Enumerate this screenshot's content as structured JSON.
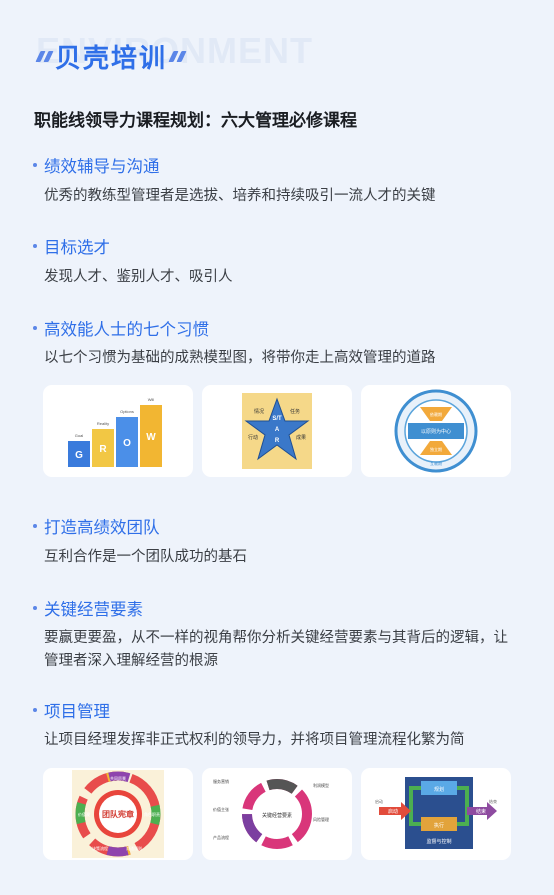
{
  "header": {
    "watermark": "ENVIRONMENT",
    "brand": "贝壳培训"
  },
  "page_title": "职能线领导力课程规划：六大管理必修课程",
  "sections": [
    {
      "title": "绩效辅导与沟通",
      "desc": "优秀的教练型管理者是选拔、培养和持续吸引一流人才的关键"
    },
    {
      "title": "目标选才",
      "desc": "发现人才、鉴别人才、吸引人"
    },
    {
      "title": "高效能人士的七个习惯",
      "desc": "以七个习惯为基础的成熟模型图，将带你走上高效管理的道路"
    },
    {
      "title": "打造高绩效团队",
      "desc": "互利合作是一个团队成功的基石"
    },
    {
      "title": "关键经营要素",
      "desc": "要赢更要盈，从不一样的视角帮你分析关键经营要素与其背后的逻辑，让管理者深入理解经营的根源"
    },
    {
      "title": "项目管理",
      "desc": "让项目经理发挥非正式权利的领导力，并将项目管理流程化繁为简"
    }
  ],
  "gallery1": {
    "grow": {
      "letters": [
        "G",
        "R",
        "O",
        "W"
      ],
      "step_labels": [
        "Goal",
        "Reality",
        "Options",
        "Will"
      ]
    },
    "star": {
      "letters": [
        "S/T",
        "A",
        "R"
      ],
      "labels": [
        "情况",
        "任务",
        "行动",
        "成果"
      ]
    },
    "circle": {
      "labels": [
        "以原则为中心",
        "依赖期",
        "独立期",
        "互赖期"
      ]
    }
  },
  "gallery2": {
    "team": {
      "center": "团队宪章",
      "ring_labels": [
        "共同愿景",
        "角色职责",
        "沟通规则",
        "决策流程",
        "价值观"
      ]
    },
    "wheel": {
      "center": "关键经营要素",
      "labels": [
        "服务营销",
        "价值主张",
        "产品流程",
        "利润模型",
        "风险管理"
      ]
    },
    "flow": {
      "labels": [
        "规划",
        "启动",
        "执行",
        "结束",
        "监督与控制"
      ],
      "side_labels": [
        "启动",
        "结束"
      ]
    }
  },
  "colors": {
    "accent": "#2f6fe8",
    "background": "#eef3fb",
    "card": "#ffffff"
  }
}
